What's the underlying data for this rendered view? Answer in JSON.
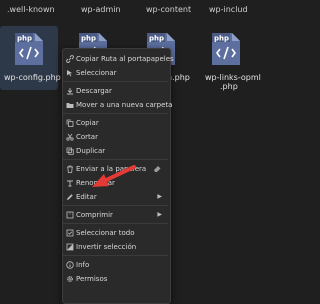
{
  "top_folders": [
    ".well-known",
    "wp-admin",
    "wp-content",
    "wp-includ"
  ],
  "files": [
    {
      "badge": "php",
      "name": "wp-config.php",
      "selected": true
    },
    {
      "badge": "php",
      "name": ""
    },
    {
      "badge": "php",
      "name": "n.php"
    },
    {
      "badge": "php",
      "name": "wp-links-opml",
      "name2": ".php"
    }
  ],
  "context_menu": {
    "items": [
      {
        "label": "Copiar Ruta al portapapeles",
        "icon": "link-icon"
      },
      {
        "label": "Seleccionar",
        "icon": "select-icon"
      },
      {
        "label": "Descargar",
        "icon": "download-icon"
      },
      {
        "label": "Mover a una nueva carpeta",
        "icon": "move-folder-icon"
      },
      {
        "label": "Copiar",
        "icon": "copy-icon"
      },
      {
        "label": "Cortar",
        "icon": "scissors-icon"
      },
      {
        "label": "Duplicar",
        "icon": "duplicate-icon"
      },
      {
        "label": "Enviar a la papelera",
        "icon": "trash-icon"
      },
      {
        "label": "Renombrar",
        "icon": "rename-icon"
      },
      {
        "label": "Editar",
        "icon": "pencil-icon",
        "submenu": true
      },
      {
        "label": "Comprimir",
        "icon": "compress-icon",
        "submenu": true
      },
      {
        "label": "Seleccionar todo",
        "icon": "select-all-icon"
      },
      {
        "label": "Invertir selección",
        "icon": "invert-selection-icon"
      },
      {
        "label": "Info",
        "icon": "info-icon"
      },
      {
        "label": "Permisos",
        "icon": "gear-icon"
      }
    ]
  },
  "colors": {
    "accent_file": "#5c6f9f",
    "background": "#1f1f1f",
    "menu": "#2a2a2a",
    "pointer": "#e53935"
  }
}
